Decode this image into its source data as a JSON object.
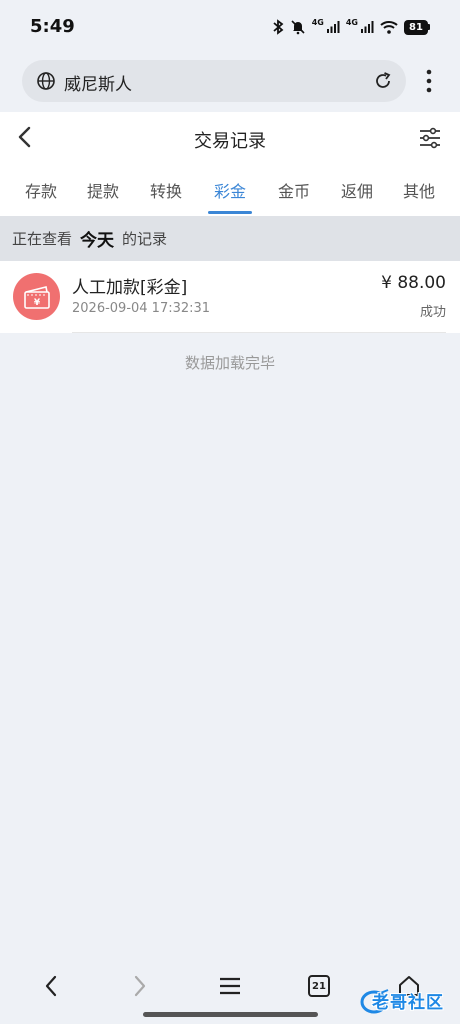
{
  "status_bar": {
    "time": "5:49",
    "network_1": "4G",
    "network_2": "4G",
    "battery": "81"
  },
  "browser": {
    "site_name": "威尼斯人",
    "icons": [
      "globe-icon",
      "reload-icon",
      "more-vert-icon"
    ]
  },
  "header": {
    "title": "交易记录",
    "icons": [
      "back-arrow-icon",
      "filter-sliders-icon"
    ]
  },
  "tabs": [
    {
      "label": "存款",
      "active": false
    },
    {
      "label": "提款",
      "active": false
    },
    {
      "label": "转换",
      "active": false
    },
    {
      "label": "彩金",
      "active": true
    },
    {
      "label": "金币",
      "active": false
    },
    {
      "label": "返佣",
      "active": false
    },
    {
      "label": "其他",
      "active": false
    }
  ],
  "viewing": {
    "prefix": "正在查看",
    "period": "今天",
    "suffix": "的记录"
  },
  "records": [
    {
      "title": "人工加款[彩金]",
      "time": "2026-09-04 17:32:31",
      "amount": "¥ 88.00",
      "status": "成功",
      "icon": "wallet-yuan-icon"
    }
  ],
  "footer": {
    "loaded_text": "数据加载完毕"
  },
  "bottom_nav": {
    "tab_count": "21",
    "icons": [
      "back-icon",
      "forward-icon",
      "menu-icon",
      "tabs-icon",
      "home-icon"
    ]
  },
  "watermark": {
    "text": "老哥社区",
    "subtext": "LAOGESHEQU"
  },
  "colors": {
    "accent": "#3b86d6",
    "record_icon_bg": "#f07070",
    "page_bg": "#eef1f6"
  }
}
